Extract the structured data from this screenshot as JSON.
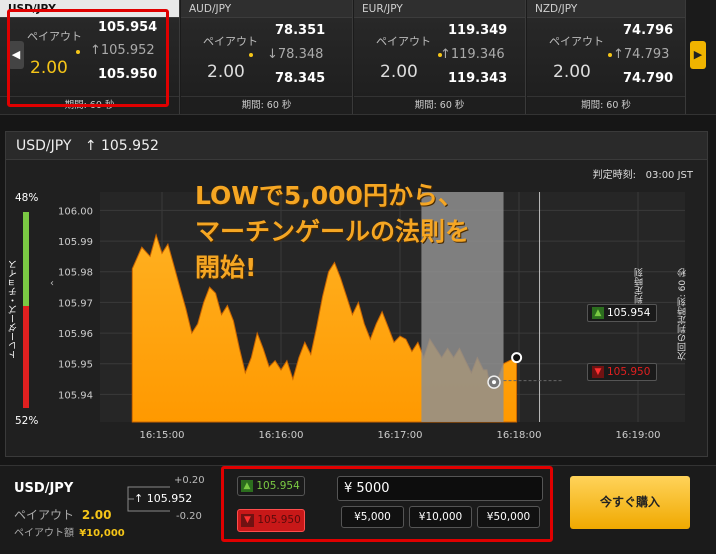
{
  "tiles": [
    {
      "pair": "USD/JPY",
      "payout_label": "ペイアウト",
      "payout": "2.00",
      "high": "105.954",
      "mid": "↑105.952",
      "low": "105.950",
      "period": "期間: 60 秒"
    },
    {
      "pair": "AUD/JPY",
      "payout_label": "ペイアウト",
      "payout": "2.00",
      "high": "78.351",
      "mid": "↓78.348",
      "low": "78.345",
      "period": "期間: 60 秒"
    },
    {
      "pair": "EUR/JPY",
      "payout_label": "ペイアウト",
      "payout": "2.00",
      "high": "119.349",
      "mid": "↑119.346",
      "low": "119.343",
      "period": "期間: 60 秒"
    },
    {
      "pair": "NZD/JPY",
      "payout_label": "ペイアウト",
      "payout": "2.00",
      "high": "74.796",
      "mid": "↑74.793",
      "low": "74.790",
      "period": "期間: 60 秒"
    }
  ],
  "header": {
    "pair": "USD/JPY",
    "rate": "↑ 105.952",
    "deadline_label": "判定時刻:",
    "deadline": "03:00 JST"
  },
  "sentiment": {
    "top": "48%",
    "bottom": "52%",
    "label": "トレーダーズ・チョイス",
    "up_color": "#7ac943",
    "down_color": "#e02020"
  },
  "overlay": {
    "line1": "LOWで5,000円から、",
    "line2": "マーチンゲールの法則を",
    "line3": "開始!",
    "color": "#f5a623"
  },
  "chart_data": {
    "type": "area",
    "ylim": [
      105.931,
      106.006
    ],
    "y_ticks": [
      "106.00",
      "105.99",
      "105.98",
      "105.97",
      "105.96",
      "105.95",
      "105.94"
    ],
    "x_ticks": [
      "16:15:00",
      "16:16:00",
      "16:17:00",
      "16:18:00",
      "16:19:00"
    ],
    "x_start_min": 0,
    "color": "#ff9900",
    "series": [
      [
        -0.25,
        105.981
      ],
      [
        -0.17,
        105.988
      ],
      [
        -0.1,
        105.985
      ],
      [
        -0.05,
        105.992
      ],
      [
        0.0,
        105.986
      ],
      [
        0.05,
        105.989
      ],
      [
        0.1,
        105.982
      ],
      [
        0.15,
        105.975
      ],
      [
        0.2,
        105.968
      ],
      [
        0.25,
        105.96
      ],
      [
        0.3,
        105.963
      ],
      [
        0.35,
        105.97
      ],
      [
        0.4,
        105.975
      ],
      [
        0.45,
        105.973
      ],
      [
        0.5,
        105.966
      ],
      [
        0.55,
        105.969
      ],
      [
        0.6,
        105.964
      ],
      [
        0.65,
        105.955
      ],
      [
        0.7,
        105.947
      ],
      [
        0.75,
        105.952
      ],
      [
        0.8,
        105.96
      ],
      [
        0.85,
        105.955
      ],
      [
        0.9,
        105.949
      ],
      [
        0.95,
        105.951
      ],
      [
        1.0,
        105.948
      ],
      [
        1.05,
        105.951
      ],
      [
        1.1,
        105.945
      ],
      [
        1.15,
        105.952
      ],
      [
        1.2,
        105.957
      ],
      [
        1.25,
        105.953
      ],
      [
        1.3,
        105.962
      ],
      [
        1.35,
        105.972
      ],
      [
        1.4,
        105.98
      ],
      [
        1.45,
        105.983
      ],
      [
        1.5,
        105.978
      ],
      [
        1.55,
        105.972
      ],
      [
        1.6,
        105.966
      ],
      [
        1.65,
        105.97
      ],
      [
        1.7,
        105.963
      ],
      [
        1.75,
        105.958
      ],
      [
        1.8,
        105.963
      ],
      [
        1.85,
        105.967
      ],
      [
        1.9,
        105.962
      ],
      [
        1.95,
        105.957
      ],
      [
        2.0,
        105.959
      ],
      [
        2.05,
        105.958
      ],
      [
        2.1,
        105.954
      ],
      [
        2.15,
        105.957
      ],
      [
        2.2,
        105.952
      ],
      [
        2.25,
        105.958
      ],
      [
        2.3,
        105.955
      ],
      [
        2.35,
        105.952
      ],
      [
        2.4,
        105.955
      ],
      [
        2.45,
        105.952
      ],
      [
        2.5,
        105.955
      ],
      [
        2.55,
        105.951
      ],
      [
        2.6,
        105.947
      ],
      [
        2.65,
        105.952
      ],
      [
        2.7,
        105.948
      ],
      [
        2.73,
        105.948
      ],
      [
        2.75,
        105.944
      ],
      [
        2.79,
        105.943
      ],
      [
        2.83,
        105.946
      ],
      [
        2.87,
        105.95
      ],
      [
        2.92,
        105.951
      ],
      [
        2.98,
        105.952
      ]
    ],
    "entry_point": [
      2.79,
      105.944
    ],
    "current_point": [
      2.98,
      105.952
    ],
    "judgement_start": 2.18,
    "judgement_end": 2.87,
    "judgement_label": "判定時刻",
    "next_label": "次回の判定時刻: 60 秒",
    "high_rate": "105.954",
    "low_rate": "105.950",
    "high_color": "#7ac943",
    "low_color": "#e02020"
  },
  "trade": {
    "pair": "USD/JPY",
    "payout_label": "ペイアウト",
    "payout": "2.00",
    "payout_amount_label": "ペイアウト額",
    "payout_amount": "¥10,000",
    "rate": "105.952",
    "plus": "+0.20",
    "minus": "-0.20",
    "high_btn": "105.954",
    "low_btn": "105.950",
    "amount": "¥ 5000",
    "presets": [
      "¥5,000",
      "¥10,000",
      "¥50,000"
    ],
    "buy": "今すぐ購入"
  }
}
